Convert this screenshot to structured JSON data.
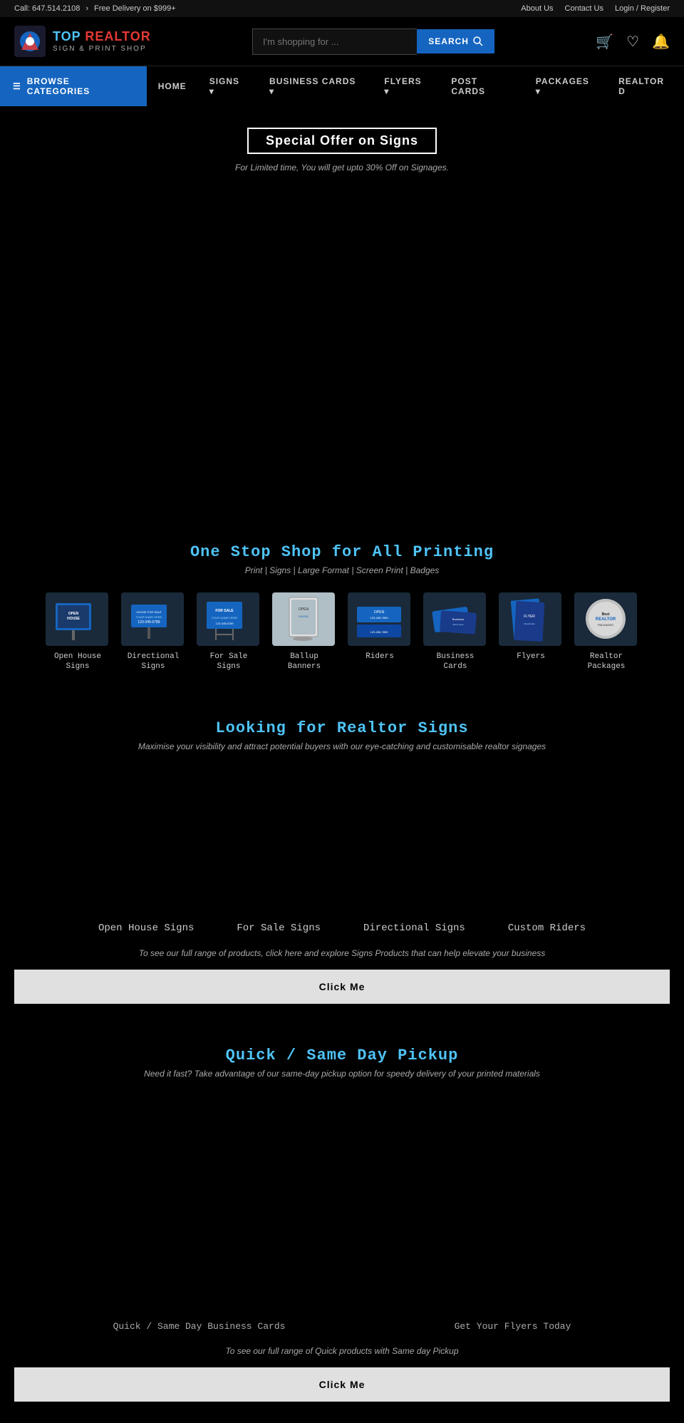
{
  "topbar": {
    "phone": "Call: 647.514.2108",
    "delivery": "Free Delivery on $999+",
    "about": "About Us",
    "contact": "Contact Us",
    "login": "Login / Register"
  },
  "header": {
    "logo_top": "TOP REALTOR",
    "logo_bottom": "SIGN & PRINT SHOP",
    "search_placeholder": "I'm shopping for ...",
    "search_button": "SEARCH"
  },
  "nav": {
    "browse": "BROWSE CATEGORIES",
    "links": [
      "HOME",
      "SIGNS",
      "BUSINESS CARDS",
      "FLYERS",
      "POST CARDS",
      "PACKAGES",
      "REALTOR D"
    ]
  },
  "hero": {
    "offer_title": "Special Offer on Signs",
    "offer_sub": "For Limited time, You will get upto 30% Off on Signages."
  },
  "products_section": {
    "title": "One Stop Shop for All Printing",
    "sub": "Print | Signs | Large Format | Screen Print | Badges",
    "items": [
      {
        "label": "Open House\nSigns",
        "type": "open-house"
      },
      {
        "label": "Directional Signs",
        "type": "directional"
      },
      {
        "label": "For Sale Signs",
        "type": "for-sale"
      },
      {
        "label": "Ballup Banners",
        "type": "banner",
        "highlighted": true
      },
      {
        "label": "Riders",
        "type": "riders"
      },
      {
        "label": "Business Cards",
        "type": "business-cards"
      },
      {
        "label": "Flyers",
        "type": "flyers"
      },
      {
        "label": "Realtor Packages",
        "type": "packages"
      }
    ]
  },
  "signs_section": {
    "title": "Looking for Realtor Signs",
    "sub": "Maximise your visibility and attract potential buyers with our eye-catching and customisable realtor signages",
    "labels": [
      "Open House Signs",
      "For Sale Signs",
      "Directional Signs",
      "Custom Riders"
    ],
    "desc": "To see our full range of products, click here and explore Signs Products that can help elevate your business",
    "button": "Click Me"
  },
  "pickup_section": {
    "title": "Quick / Same Day Pickup",
    "sub": "Need it fast? Take advantage of our same-day pickup option for speedy delivery of your printed materials",
    "labels": [
      "Quick / Same Day Business Cards",
      "Get Your Flyers Today"
    ],
    "desc": "To see our full range of Quick products with Same day Pickup",
    "button": "Click Me"
  }
}
